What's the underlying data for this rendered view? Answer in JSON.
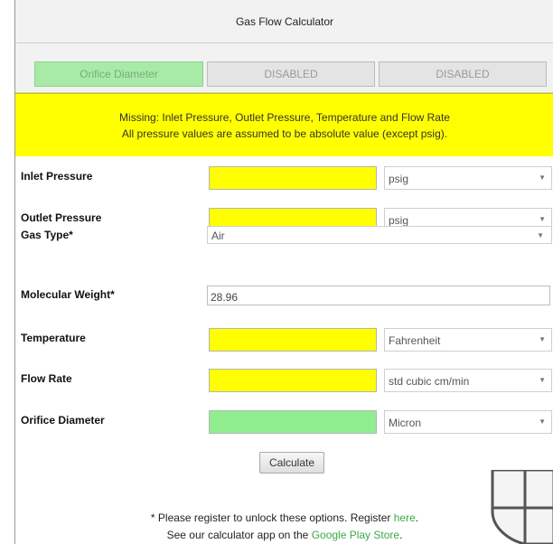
{
  "title": "Gas Flow Calculator",
  "tabs": [
    {
      "label": "Orifice Diameter",
      "active": true
    },
    {
      "label": "DISABLED",
      "active": false
    },
    {
      "label": "DISABLED",
      "active": false
    }
  ],
  "notice": {
    "line1": "Missing: Inlet Pressure, Outlet Pressure, Temperature and Flow Rate",
    "line2": "All pressure values are assumed to be absolute value (except psig)."
  },
  "fields": {
    "inlet_pressure": {
      "label": "Inlet Pressure",
      "value": "",
      "unit": "psig"
    },
    "outlet_pressure": {
      "label": "Outlet Pressure",
      "value": "",
      "unit": "psig"
    },
    "gas_type": {
      "label": "Gas Type*",
      "value": "Air"
    },
    "molecular_weight": {
      "label": "Molecular Weight*",
      "value": "28.96"
    },
    "temperature": {
      "label": "Temperature",
      "value": "",
      "unit": "Fahrenheit"
    },
    "flow_rate": {
      "label": "Flow Rate",
      "value": "",
      "unit": "std cubic cm/min"
    },
    "orifice_diameter": {
      "label": "Orifice Diameter",
      "value": "",
      "unit": "Micron"
    }
  },
  "calculate_label": "Calculate",
  "footer": {
    "line1_prefix": "* Please register to unlock these options. Register ",
    "line1_link": "here",
    "line1_suffix": ".",
    "line2_prefix": "See our calculator app on the ",
    "line2_link": "Google Play Store",
    "line2_suffix": "."
  },
  "colors": {
    "missing": "#ffff00",
    "result": "#90ee90",
    "active_tab": "#a7eba7",
    "link": "#3fa84a"
  },
  "icons": {
    "dropdown": "chevron-down-icon",
    "shield": "shield-icon"
  }
}
